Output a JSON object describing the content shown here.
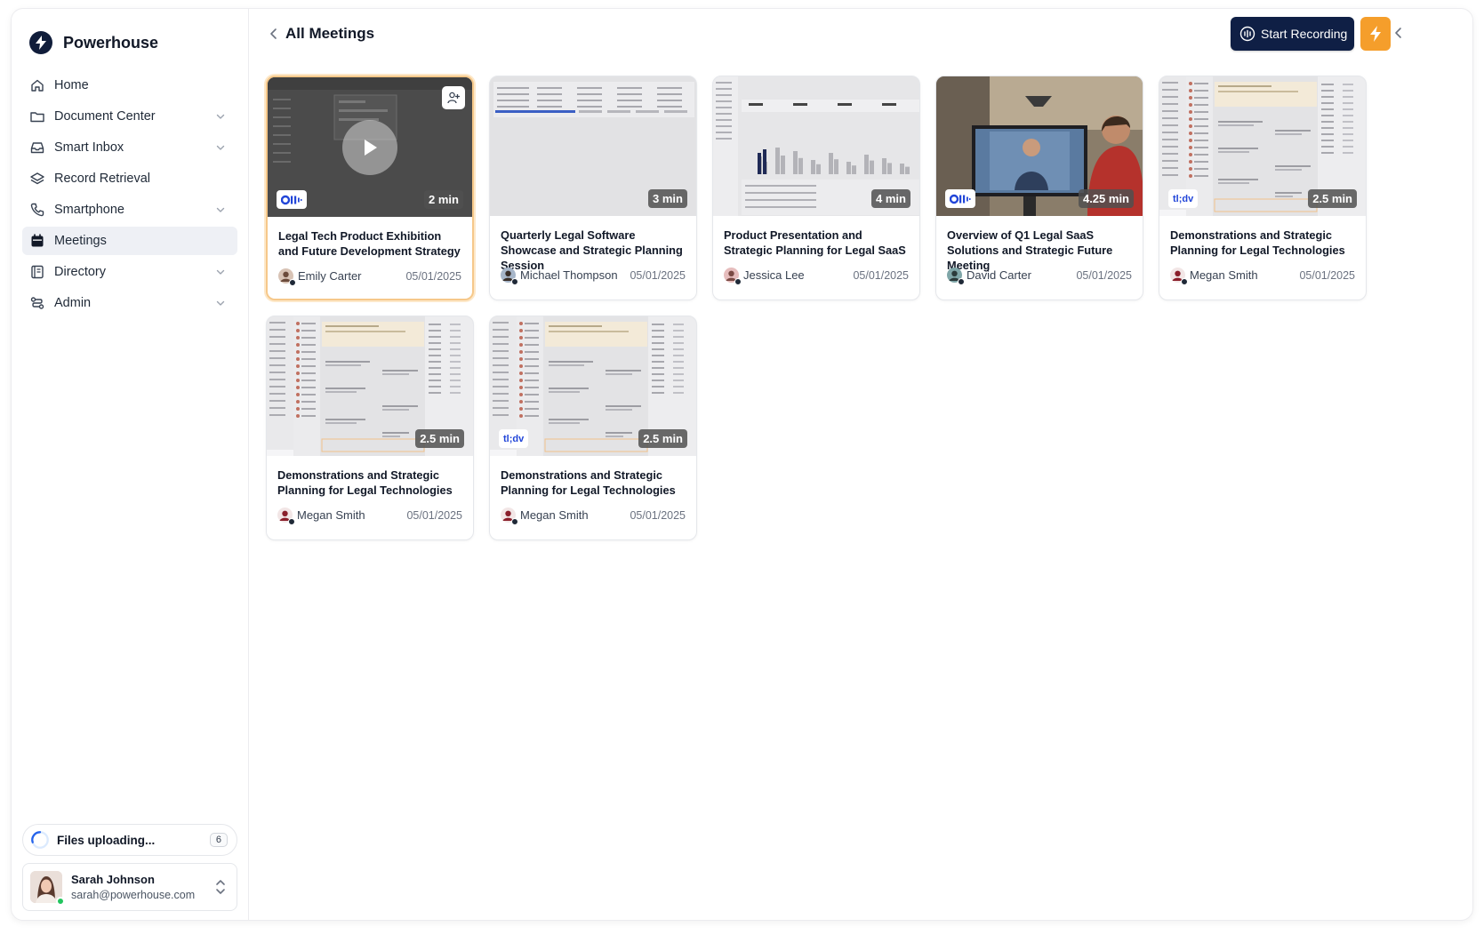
{
  "app": {
    "name": "Powerhouse"
  },
  "sidebar": {
    "items": [
      {
        "label": "Home",
        "icon": "home-icon",
        "expandable": false,
        "active": false
      },
      {
        "label": "Document Center",
        "icon": "folder-icon",
        "expandable": true,
        "active": false
      },
      {
        "label": "Smart Inbox",
        "icon": "inbox-icon",
        "expandable": true,
        "active": false
      },
      {
        "label": "Record Retrieval",
        "icon": "layers-icon",
        "expandable": false,
        "active": false
      },
      {
        "label": "Smartphone",
        "icon": "phone-icon",
        "expandable": true,
        "active": false
      },
      {
        "label": "Meetings",
        "icon": "calendar-icon",
        "expandable": false,
        "active": true
      },
      {
        "label": "Directory",
        "icon": "book-icon",
        "expandable": true,
        "active": false
      },
      {
        "label": "Admin",
        "icon": "route-icon",
        "expandable": true,
        "active": false
      }
    ],
    "upload": {
      "label": "Files uploading...",
      "count": "6"
    },
    "user": {
      "name": "Sarah Johnson",
      "email": "sarah@powerhouse.com",
      "status": "online"
    }
  },
  "header": {
    "title": "All Meetings",
    "record_label": "Start Recording"
  },
  "colors": {
    "primary": "#0f1f45",
    "accent": "#f59e2b",
    "selected_border": "#f6c88a"
  },
  "meetings": [
    {
      "title": "Legal Tech Product Exhibition and Future Development Strategy",
      "owner": "Emily Carter",
      "date": "05/01/2025",
      "duration": "2 min",
      "source": "otter",
      "thumb": "dark-doc",
      "selected": true
    },
    {
      "title": "Quarterly Legal Software Showcase and Strategic Planning Session",
      "owner": "Michael Thompson",
      "date": "05/01/2025",
      "duration": "3 min",
      "source": "",
      "thumb": "table",
      "selected": false
    },
    {
      "title": "Product Presentation and Strategic Planning for Legal SaaS",
      "owner": "Jessica Lee",
      "date": "05/01/2025",
      "duration": "4 min",
      "source": "",
      "thumb": "dashboard",
      "selected": false
    },
    {
      "title": "Overview of Q1 Legal SaaS Solutions and Strategic Future Meeting",
      "owner": "David Carter",
      "date": "05/01/2025",
      "duration": "4.25 min",
      "source": "otter",
      "thumb": "photo",
      "selected": false
    },
    {
      "title": "Demonstrations and Strategic Planning for Legal Technologies",
      "owner": "Megan Smith",
      "date": "05/01/2025",
      "duration": "2.5 min",
      "source": "tldv",
      "thumb": "chat",
      "selected": false
    },
    {
      "title": "Demonstrations and Strategic Planning for Legal Technologies",
      "owner": "Megan Smith",
      "date": "05/01/2025",
      "duration": "2.5 min",
      "source": "",
      "thumb": "chat",
      "selected": false
    },
    {
      "title": "Demonstrations and Strategic Planning for Legal Technologies",
      "owner": "Megan Smith",
      "date": "05/01/2025",
      "duration": "2.5 min",
      "source": "tldv",
      "thumb": "chat",
      "selected": false
    }
  ],
  "source_labels": {
    "otter": "Oll·",
    "tldv": "tl;dv"
  }
}
